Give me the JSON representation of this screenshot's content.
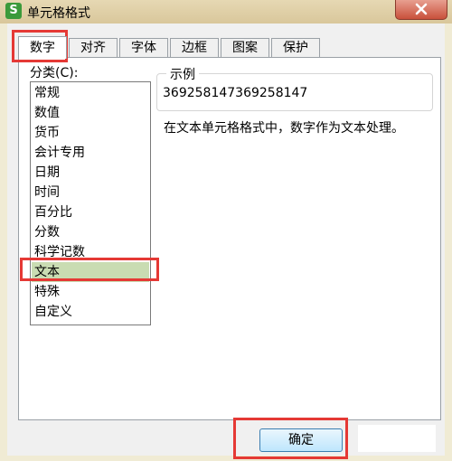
{
  "window": {
    "icon_letter": "S",
    "title": "单元格格式"
  },
  "tabs": [
    {
      "label": "数字",
      "active": true
    },
    {
      "label": "对齐"
    },
    {
      "label": "字体"
    },
    {
      "label": "边框"
    },
    {
      "label": "图案"
    },
    {
      "label": "保护"
    }
  ],
  "category": {
    "label": "分类(C):",
    "items": [
      "常规",
      "数值",
      "货币",
      "会计专用",
      "日期",
      "时间",
      "百分比",
      "分数",
      "科学记数",
      "文本",
      "特殊",
      "自定义"
    ],
    "selected": "文本"
  },
  "example": {
    "legend": "示例",
    "value": "369258147369258147"
  },
  "description": "在文本单元格格式中，数字作为文本处理。",
  "buttons": {
    "ok": "确定"
  },
  "colors": {
    "highlight": "#e53935",
    "selected_item": "#c9dcb2",
    "title_bar": "#dccca2"
  }
}
